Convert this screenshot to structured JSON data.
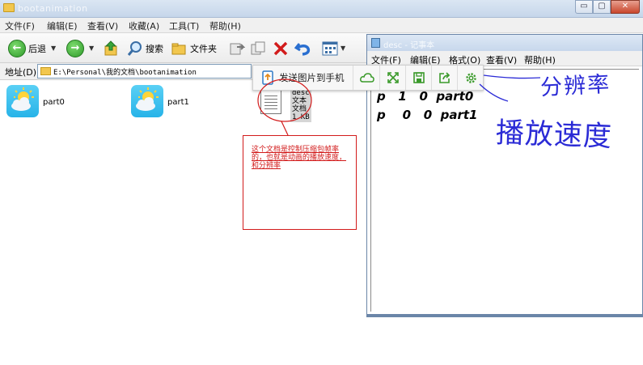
{
  "explorer": {
    "title": "bootanimation",
    "window_buttons": {
      "minimize": "▭",
      "maximize": "▢",
      "close": "✕"
    },
    "menu": [
      "文件(F)",
      "编辑(E)",
      "查看(V)",
      "收藏(A)",
      "工具(T)",
      "帮助(H)"
    ],
    "toolbar": {
      "back": "后退",
      "search": "搜索",
      "folders": "文件夹"
    },
    "address": {
      "label": "地址(D)",
      "path": "E:\\Personal\\我的文档\\bootanimation"
    },
    "files": [
      {
        "name": "part0"
      },
      {
        "name": "part1"
      }
    ],
    "doc_file": {
      "name": "desc",
      "type": "文本文档",
      "size": "1 KB"
    }
  },
  "annotation_box": {
    "text": "这个文档是控制压缩包帧率的，也就是动画的播放速度，和分辨率"
  },
  "share_bar": {
    "send_label": "发送图片到手机",
    "icons": [
      "cloud-icon",
      "expand-icon",
      "save-icon",
      "share-icon",
      "settings-icon"
    ]
  },
  "notepad": {
    "title": "desc - 记事本",
    "menu": [
      "文件(F)",
      "编辑(E)",
      "格式(O)",
      "查看(V)",
      "帮助(H)"
    ],
    "lines": [
      "p   1   0  part0",
      "p    0   0  part1"
    ]
  },
  "handwriting": {
    "resolution": "分辨率",
    "speed": "播放速度"
  },
  "colors": {
    "accent_red": "#d21b1b",
    "handwriting_blue": "#2b2bd6",
    "share_green": "#3a9a2a"
  }
}
